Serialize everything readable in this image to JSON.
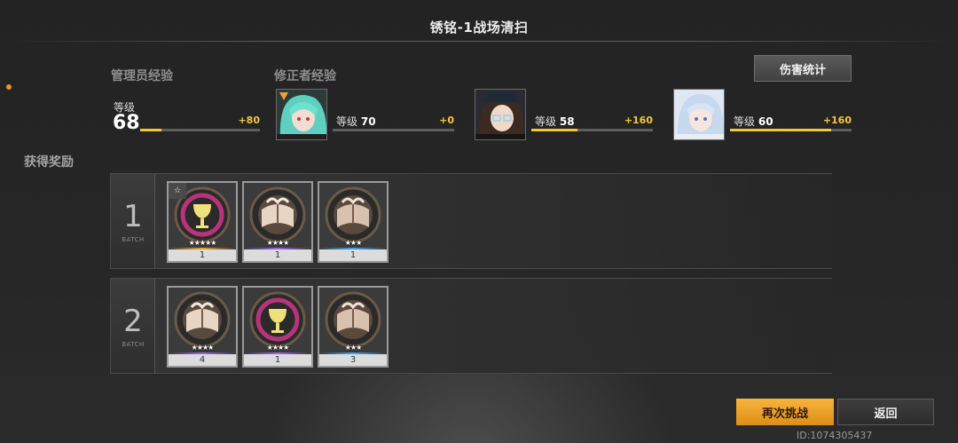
{
  "title": "锈铭-1战场清扫",
  "damage_stats_label": "伤害统计",
  "manager_exp": {
    "heading": "管理员经验",
    "level_label": "等级",
    "level": "68",
    "exp_gain": "+80",
    "progress": 0.18
  },
  "corrector_exp": {
    "heading": "修正者经验",
    "characters": [
      {
        "level_label": "等级",
        "level": "70",
        "exp_gain": "+0",
        "progress": 0.0,
        "portrait_icon": "teal-hair-character-portrait"
      },
      {
        "level_label": "等级",
        "level": "58",
        "exp_gain": "+160",
        "progress": 0.38,
        "portrait_icon": "dark-hair-glasses-character-portrait"
      },
      {
        "level_label": "等级",
        "level": "60",
        "exp_gain": "+160",
        "progress": 0.83,
        "portrait_icon": "white-hair-character-portrait"
      }
    ]
  },
  "rewards_heading": "获得奖励",
  "batch_sub_label": "BATCH",
  "batches": [
    {
      "number": "1",
      "items": [
        {
          "icon": "goblet-crest-icon",
          "stars": "★★★★★",
          "quantity": "1",
          "rarity_color": "#e8a33a",
          "badge": "☆"
        },
        {
          "icon": "book-crest-icon",
          "stars": "★★★★",
          "quantity": "1",
          "rarity_color": "#9b6be0"
        },
        {
          "icon": "book-crest-icon",
          "stars": "★★★",
          "quantity": "1",
          "rarity_color": "#4aa3e8"
        }
      ]
    },
    {
      "number": "2",
      "items": [
        {
          "icon": "book-crest-icon",
          "stars": "★★★★",
          "quantity": "4",
          "rarity_color": "#9b6be0"
        },
        {
          "icon": "goblet-crest-icon",
          "stars": "★★★★",
          "quantity": "1",
          "rarity_color": "#9b6be0"
        },
        {
          "icon": "book-crest-icon",
          "stars": "★★★",
          "quantity": "3",
          "rarity_color": "#4aa3e8"
        }
      ]
    }
  ],
  "challenge_again_label": "再次挑战",
  "return_label": "返回",
  "user_id": "ID:1074305437"
}
